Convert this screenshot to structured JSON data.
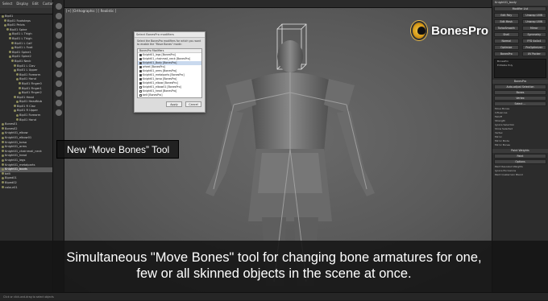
{
  "explorer": {
    "menu": [
      "Select",
      "Display",
      "Edit",
      "Customize"
    ],
    "tree": [
      {
        "label": "Bip01",
        "depth": 0,
        "selected": false
      },
      {
        "label": "Bip01 Footsteps",
        "depth": 1,
        "selected": false
      },
      {
        "label": "Bip01 Pelvis",
        "depth": 1,
        "selected": false
      },
      {
        "label": "Bip01 Spine",
        "depth": 2,
        "selected": false
      },
      {
        "label": "Bip01 L Thigh",
        "depth": 3,
        "selected": false
      },
      {
        "label": "Bip01 L Thigh",
        "depth": 3,
        "selected": false
      },
      {
        "label": "Bip01 L Calf",
        "depth": 4,
        "selected": false
      },
      {
        "label": "Bip01 L Foot",
        "depth": 4,
        "selected": false
      },
      {
        "label": "Bip01 Spine1",
        "depth": 3,
        "selected": false
      },
      {
        "label": "Bip01 Spine2",
        "depth": 3,
        "selected": false
      },
      {
        "label": "Bip01 Neck",
        "depth": 4,
        "selected": false
      },
      {
        "label": "Bip01 L Clav",
        "depth": 5,
        "selected": false
      },
      {
        "label": "Bip01 L Upper",
        "depth": 5,
        "selected": false
      },
      {
        "label": "Bip01 Forearm",
        "depth": 6,
        "selected": false
      },
      {
        "label": "Bip01 Hand",
        "depth": 6,
        "selected": false
      },
      {
        "label": "Bip01 Finger0",
        "depth": 7,
        "selected": false
      },
      {
        "label": "Bip01 Finger1",
        "depth": 7,
        "selected": false
      },
      {
        "label": "Bip01 Finger2",
        "depth": 7,
        "selected": false
      },
      {
        "label": "Bip01 Head",
        "depth": 5,
        "selected": false
      },
      {
        "label": "Bip01 HeadNub",
        "depth": 6,
        "selected": false
      },
      {
        "label": "Bip01 R Clav",
        "depth": 5,
        "selected": false
      },
      {
        "label": "Bip01 R Upper",
        "depth": 5,
        "selected": false
      },
      {
        "label": "Bip01 Forearm",
        "depth": 6,
        "selected": false
      },
      {
        "label": "Bip01 Hand",
        "depth": 6,
        "selected": false
      },
      {
        "label": "Bones01",
        "depth": 0,
        "selected": false
      },
      {
        "label": "Bones02",
        "depth": 0,
        "selected": false
      },
      {
        "label": "Knight01_elbow",
        "depth": 0,
        "selected": false
      },
      {
        "label": "Knight01_elbow01",
        "depth": 0,
        "selected": false
      },
      {
        "label": "Knight01_torso",
        "depth": 0,
        "selected": false
      },
      {
        "label": "Knight01_arms",
        "depth": 0,
        "selected": false
      },
      {
        "label": "Knight01_chainmail_neck",
        "depth": 0,
        "selected": false
      },
      {
        "label": "Knight01_head",
        "depth": 0,
        "selected": false
      },
      {
        "label": "Knight01_legs",
        "depth": 0,
        "selected": false
      },
      {
        "label": "Knight01_metalparts",
        "depth": 0,
        "selected": false
      },
      {
        "label": "Knight01_boots",
        "depth": 0,
        "selected": true
      },
      {
        "label": "belt",
        "depth": 0,
        "selected": false
      },
      {
        "label": "Biped01",
        "depth": 0,
        "selected": false
      },
      {
        "label": "Biped02",
        "depth": 0,
        "selected": false
      },
      {
        "label": "colour01",
        "depth": 0,
        "selected": false
      }
    ]
  },
  "viewport": {
    "label": "[+] [Orthographic ] [ Realistic ]"
  },
  "dialog": {
    "title": "Select BonesPro modifiers",
    "description": "Select the BonesPro modifiers for which you want to enable the \"Move Bones\" mode:",
    "list_header": "BonesPro Modifiers",
    "items": [
      {
        "label": "Knight01_legs [BonesPro]",
        "checked": true,
        "selected": false
      },
      {
        "label": "Knight01_chainmail_neck [BonesPro]",
        "checked": true,
        "selected": false
      },
      {
        "label": "Knight01_Body [BonesPro]",
        "checked": true,
        "selected": true
      },
      {
        "label": "wheel [BonesPro]",
        "checked": true,
        "selected": false
      },
      {
        "label": "Knight01_arms [BonesPro]",
        "checked": true,
        "selected": false
      },
      {
        "label": "Knight01_metalparts [BonesPro]",
        "checked": true,
        "selected": false
      },
      {
        "label": "Knight01_torso [BonesPro]",
        "checked": true,
        "selected": false
      },
      {
        "label": "Knight01_elbow [BonesPro]",
        "checked": true,
        "selected": false
      },
      {
        "label": "Knight01_elbow01 [BonesPro]",
        "checked": false,
        "selected": false
      },
      {
        "label": "Knight01_head [BonesPro]",
        "checked": false,
        "selected": false
      },
      {
        "label": "belt [BonesPro]",
        "checked": false,
        "selected": false
      }
    ],
    "apply_label": "Apply",
    "cancel_label": "Cancel"
  },
  "logo": {
    "name": "BonesPro"
  },
  "right_panel": {
    "object_name": "Knight01_body",
    "modifier_list": "Modifier List",
    "buttons": [
      [
        "Edit Poly",
        "Unwrap UVW"
      ],
      [
        "Edit Mesh",
        "Unwrap UVW"
      ],
      [
        "TurboSmooth",
        "Mirror"
      ],
      [
        "Shell",
        "Symmetry"
      ],
      [
        "Normal",
        "FFD 4x4x4"
      ],
      [
        "Optimize",
        "ProOptimizer"
      ],
      [
        "BonesPro",
        "UV Packer"
      ]
    ],
    "stack": [
      "BonesPro",
      "Editable Poly"
    ],
    "rollout_title": "BonesPro",
    "rollout_items": [
      "Auto-adjust Selection",
      "Bones",
      "Vertex",
      "Select ..."
    ],
    "sections": [
      "Move Bones",
      "Influences",
      "Falloff",
      "Strength",
      "Ignore Selection",
      "Show Selected",
      "Vertex",
      "Mirror",
      "Mirror Mode",
      "Mirror Bones"
    ],
    "bottom_title": "Paint Weights",
    "bottom_items": [
      "Paint",
      "Options",
      "Paint Rescaled Weights",
      "Ignore Exclusions",
      "Paint Quaternion Blend"
    ]
  },
  "callout": {
    "text": "New “Move Bones” Tool"
  },
  "caption": {
    "line1": "Simultaneous \"Move Bones\" tool for changing bone armatures for one,",
    "line2": "few or all skinned objects in the scene at once."
  },
  "status": {
    "text": "Click or click-and-drag to select objects"
  },
  "colors": {
    "accent": "#d79a18",
    "caption_bg": "#141414",
    "viewport_bg": "#5a5a5a"
  }
}
